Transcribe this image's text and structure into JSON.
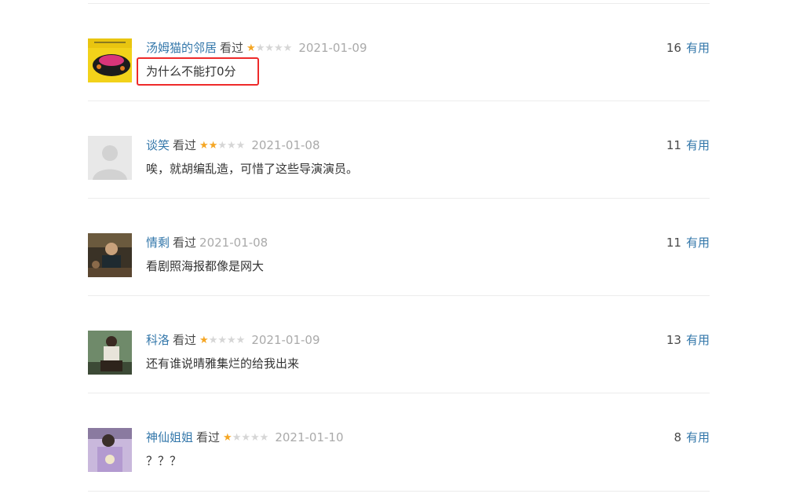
{
  "colors": {
    "link": "#3377aa",
    "star_on": "#f5a623",
    "star_off": "#d6d6d6",
    "date": "#aaaaaa",
    "highlight": "#ee2a2a",
    "separator": "#ececec"
  },
  "comments": [
    {
      "user": "汤姆猫的邻居",
      "status": "看过",
      "rating": 1,
      "date": "2021-01-09",
      "votes": "16",
      "useful_label": "有用",
      "text": "为什么不能打0分",
      "avatar_icon": "avatar-image"
    },
    {
      "user": "谈笑",
      "status": "看过",
      "rating": 2,
      "date": "2021-01-08",
      "votes": "11",
      "useful_label": "有用",
      "text": "唉，就胡编乱造，可惜了这些导演演员。",
      "avatar_icon": "default-user-icon"
    },
    {
      "user": "情剩",
      "status": "看过",
      "rating": 0,
      "date": "2021-01-08",
      "votes": "11",
      "useful_label": "有用",
      "text": "看剧照海报都像是网大",
      "avatar_icon": "avatar-image"
    },
    {
      "user": "科洛",
      "status": "看过",
      "rating": 1,
      "date": "2021-01-09",
      "votes": "13",
      "useful_label": "有用",
      "text": "还有谁说晴雅集烂的给我出来",
      "avatar_icon": "avatar-image"
    },
    {
      "user": "神仙姐姐",
      "status": "看过",
      "rating": 1,
      "date": "2021-01-10",
      "votes": "8",
      "useful_label": "有用",
      "text": "？？？",
      "avatar_icon": "avatar-image"
    }
  ]
}
